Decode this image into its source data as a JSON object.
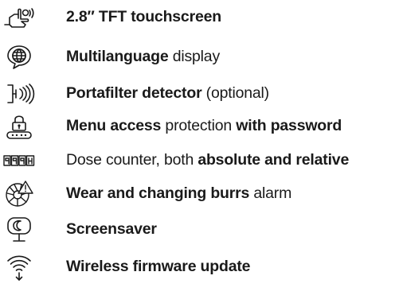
{
  "features": [
    {
      "icon": "touch-hand-icon",
      "parts": [
        {
          "t": "2.8″ TFT touchscreen",
          "b": true
        }
      ]
    },
    {
      "icon": "globe-icon",
      "parts": [
        {
          "t": "Multilanguage",
          "b": true
        },
        {
          "t": " display",
          "b": false
        }
      ]
    },
    {
      "icon": "portafilter-sensor-icon",
      "parts": [
        {
          "t": "Portafilter detector",
          "b": true
        },
        {
          "t": " (optional)",
          "b": false
        }
      ]
    },
    {
      "icon": "padlock-password-icon",
      "parts": [
        {
          "t": "Menu access",
          "b": true
        },
        {
          "t": " protection ",
          "b": false
        },
        {
          "t": "with password",
          "b": true
        }
      ]
    },
    {
      "icon": "counter-display-icon",
      "parts": [
        {
          "t": "Dose counter, both ",
          "b": false
        },
        {
          "t": "absolute and relative",
          "b": true
        }
      ]
    },
    {
      "icon": "burr-warning-icon",
      "parts": [
        {
          "t": "Wear and changing burrs",
          "b": true
        },
        {
          "t": " alarm",
          "b": false
        }
      ]
    },
    {
      "icon": "screensaver-monitor-icon",
      "parts": [
        {
          "t": "Screensaver",
          "b": true
        }
      ]
    },
    {
      "icon": "wireless-update-icon",
      "parts": [
        {
          "t": "Wireless firmware update",
          "b": true
        }
      ]
    }
  ]
}
